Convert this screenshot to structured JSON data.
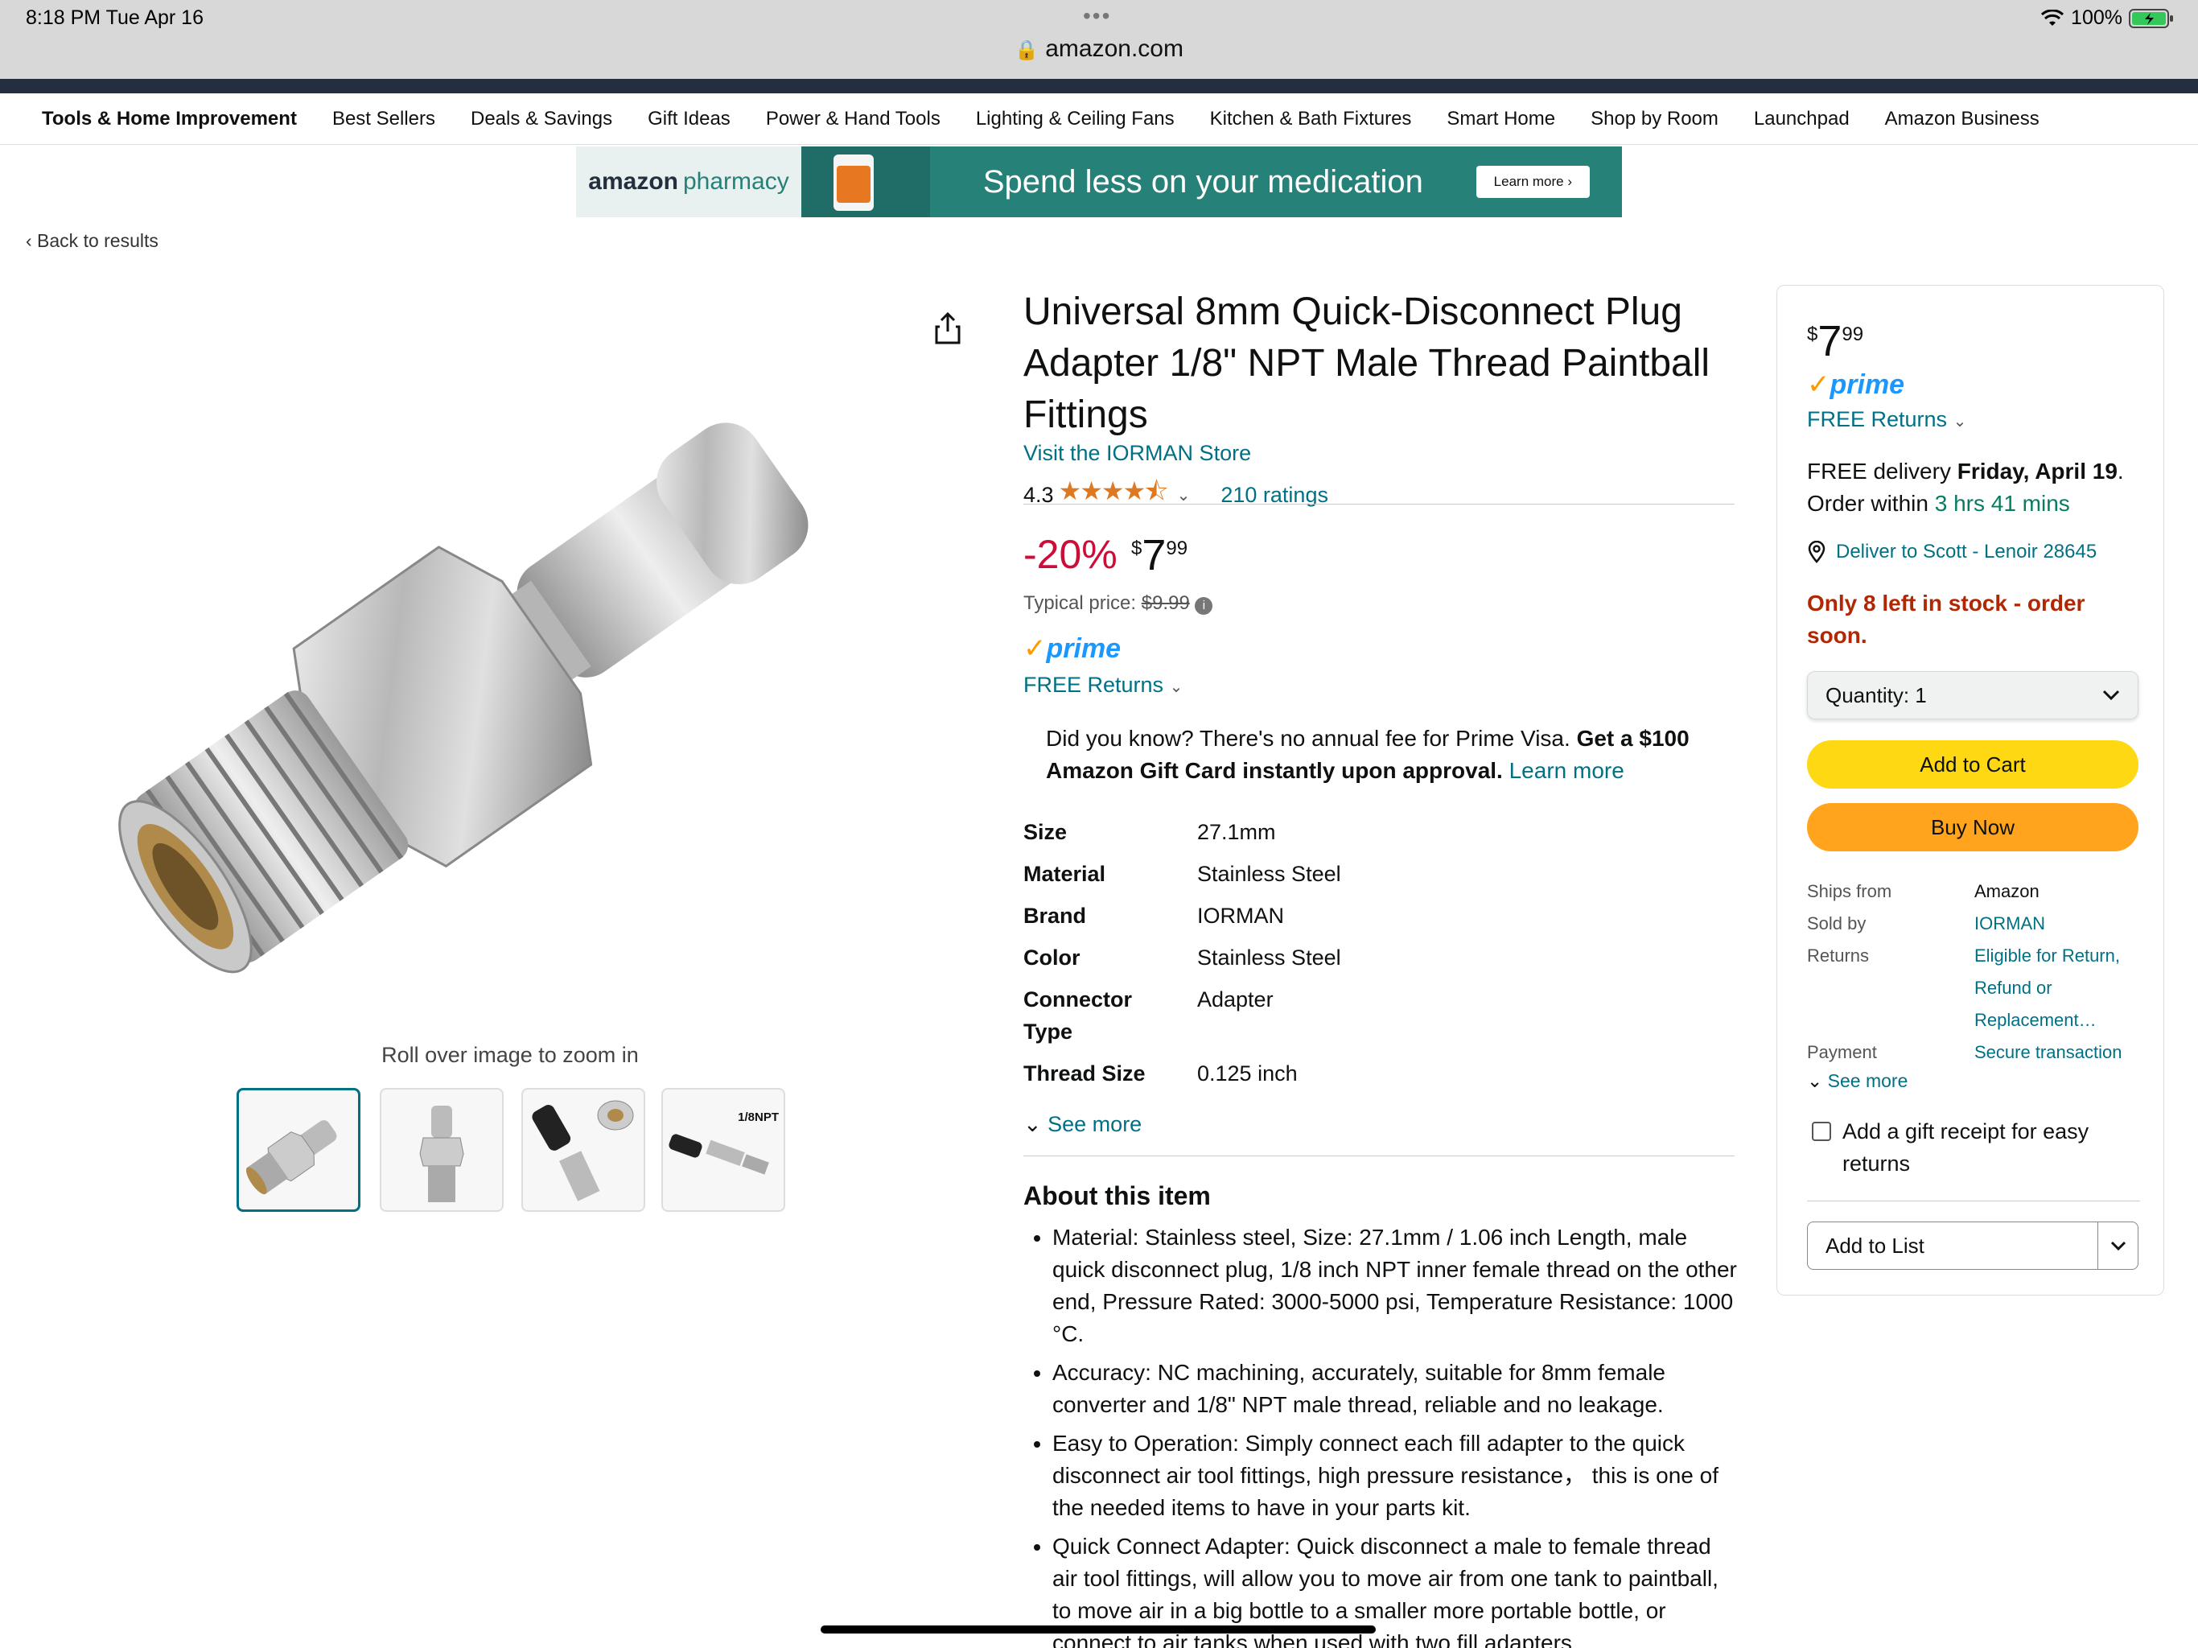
{
  "status": {
    "time": "8:18 PM   Tue Apr 16",
    "battery": "100%",
    "url": "amazon.com"
  },
  "nav": [
    "Tools & Home Improvement",
    "Best Sellers",
    "Deals & Savings",
    "Gift Ideas",
    "Power & Hand Tools",
    "Lighting & Ceiling Fans",
    "Kitchen & Bath Fixtures",
    "Smart Home",
    "Shop by Room",
    "Launchpad",
    "Amazon Business"
  ],
  "banner": {
    "logo_a": "amazon",
    "logo_b": "pharmacy",
    "text": "Spend less on your medication",
    "button": "Learn more ›"
  },
  "back": "‹  Back to results",
  "gallery": {
    "zoom_text": "Roll over image to zoom in",
    "thumb_badge": "1/8NPT"
  },
  "product": {
    "title": "Universal 8mm Quick-Disconnect Plug Adapter 1/8\" NPT Male Thread Paintball Fittings",
    "store": "Visit the IORMAN Store",
    "rating": "4.3",
    "stars": "★★★★⯪",
    "ratings_count": "210 ratings",
    "discount": "-20%",
    "price": {
      "currency": "$",
      "whole": "7",
      "fraction": "99"
    },
    "typical_label": "Typical price:",
    "typical_price": "$9.99",
    "prime": "prime",
    "returns": "FREE Returns",
    "visa_text": "Did you know? There's no annual fee for Prime Visa.",
    "visa_bold": "Get a $100 Amazon Gift Card instantly upon approval.",
    "visa_link": "Learn more",
    "specs": [
      {
        "k": "Size",
        "v": "27.1mm"
      },
      {
        "k": "Material",
        "v": "Stainless Steel"
      },
      {
        "k": "Brand",
        "v": "IORMAN"
      },
      {
        "k": "Color",
        "v": "Stainless Steel"
      },
      {
        "k": "Connector Type",
        "v": "Adapter"
      },
      {
        "k": "Thread Size",
        "v": "0.125 inch"
      }
    ],
    "see_more": "See more",
    "about_title": "About this item",
    "about": [
      "Material: Stainless steel, Size: 27.1mm / 1.06 inch Length, male quick disconnect plug, 1/8 inch NPT inner female thread on the other end, Pressure Rated: 3000-5000 psi, Temperature Resistance: 1000 °C.",
      "Accuracy: NC machining, accurately, suitable for 8mm female converter and 1/8\" NPT male thread, reliable and no leakage.",
      "Easy to Operation: Simply connect each fill adapter to the quick disconnect air tool fittings, high pressure resistance， this is one of the needed items to have in your parts kit.",
      "Quick Connect Adapter: Quick disconnect a male to female thread air tool fittings, will allow you to move air from one tank to paintball, to move air in a big bottle to a smaller more portable bottle, or connect to air tanks when used with two fill adapters"
    ]
  },
  "buybox": {
    "delivery_a": "FREE delivery",
    "delivery_date": "Friday, April 19",
    "delivery_b": "Order within",
    "countdown": "3 hrs 41 mins",
    "deliver_to": "Deliver to Scott - Lenoir 28645",
    "stock": "Only 8 left in stock - order soon.",
    "quantity": "Quantity:  1",
    "add_to_cart": "Add to Cart",
    "buy_now": "Buy Now",
    "info": [
      {
        "k": "Ships from",
        "v": "Amazon"
      },
      {
        "k": "Sold by",
        "v": "IORMAN"
      },
      {
        "k": "Returns",
        "v": "Eligible for Return, Refund or Replacement…"
      },
      {
        "k": "Payment",
        "v": "Secure transaction"
      }
    ],
    "see_more": "See more",
    "gift": "Add a gift receipt for easy returns",
    "add_to_list": "Add to List"
  }
}
